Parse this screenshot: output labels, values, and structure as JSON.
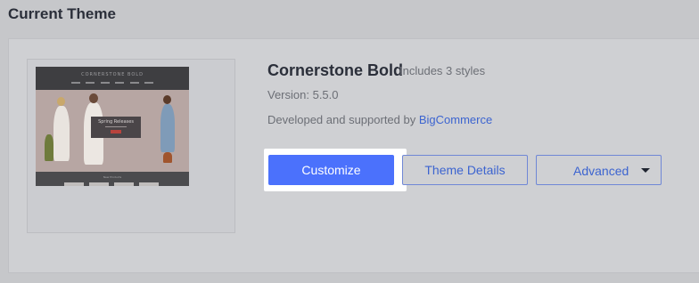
{
  "section": {
    "title": "Current Theme"
  },
  "theme": {
    "name": "Cornerstone Bold",
    "includes": "Includes 3 styles",
    "version": "Version: 5.5.0",
    "developer_prefix": "Developed and supported by ",
    "developer_link": "BigCommerce"
  },
  "preview": {
    "store_title": "CORNERSTONE BOLD",
    "banner_text": "Spring Releases",
    "footer_text": "New Products"
  },
  "actions": {
    "customize": "Customize",
    "theme_details": "Theme Details",
    "advanced": "Advanced"
  },
  "colors": {
    "primary": "#4b71fc",
    "link": "#3c64d0",
    "text": "#2b2f3a",
    "muted": "#6c6f76"
  }
}
